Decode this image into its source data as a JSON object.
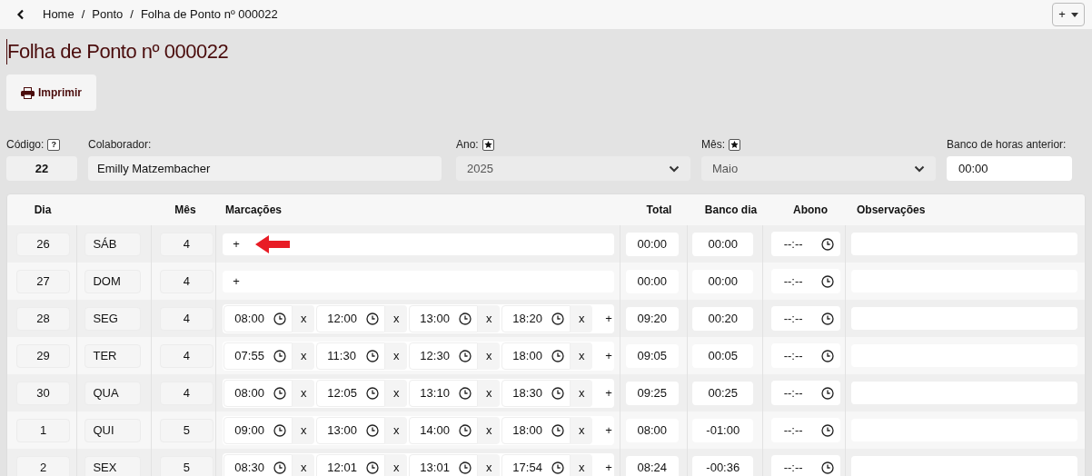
{
  "breadcrumb": [
    "Home",
    "Ponto",
    "Folha de Ponto nº 000022"
  ],
  "breadcrumb_separator": "/",
  "top_button": {
    "label": "+"
  },
  "title": "Folha de Ponto nº 000022",
  "print_button": {
    "label": "Imprimir"
  },
  "fields": [
    {
      "kind": "code",
      "label": "Código:",
      "badge": "?",
      "value": "22"
    },
    {
      "kind": "text",
      "label": "Colaborador:",
      "value": "Emilly Matzembacher"
    },
    {
      "kind": "select",
      "label": "Ano:",
      "starred": true,
      "value": "2025"
    },
    {
      "kind": "select",
      "label": "Mês:",
      "starred": true,
      "value": "Maio"
    },
    {
      "kind": "input",
      "label": "Banco de horas anterior:",
      "value": "00:00"
    }
  ],
  "table": {
    "columns": [
      "Dia",
      "",
      "Mês",
      "Marcações",
      "Total",
      "Banco dia",
      "Abono",
      "Observações"
    ],
    "rows": [
      {
        "dia": "26",
        "weekday": "SÁB",
        "mes": "4",
        "add": "+",
        "marks": [],
        "total": "00:00",
        "banco": "00:00",
        "abono": "--:--"
      },
      {
        "dia": "27",
        "weekday": "DOM",
        "mes": "4",
        "add": "+",
        "marks": [],
        "total": "00:00",
        "banco": "00:00",
        "abono": "--:--"
      },
      {
        "dia": "28",
        "weekday": "SEG",
        "mes": "4",
        "add": "+",
        "marks": [
          {
            "time": "08:00",
            "remove": "x"
          },
          {
            "time": "12:00",
            "remove": "x"
          },
          {
            "time": "13:00",
            "remove": "x"
          },
          {
            "time": "18:20",
            "remove": "x"
          }
        ],
        "total": "09:20",
        "banco": "00:20",
        "abono": "--:--"
      },
      {
        "dia": "29",
        "weekday": "TER",
        "mes": "4",
        "add": "+",
        "marks": [
          {
            "time": "07:55",
            "remove": "x"
          },
          {
            "time": "11:30",
            "remove": "x"
          },
          {
            "time": "12:30",
            "remove": "x"
          },
          {
            "time": "18:00",
            "remove": "x"
          }
        ],
        "total": "09:05",
        "banco": "00:05",
        "abono": "--:--"
      },
      {
        "dia": "30",
        "weekday": "QUA",
        "mes": "4",
        "add": "+",
        "marks": [
          {
            "time": "08:00",
            "remove": "x"
          },
          {
            "time": "12:05",
            "remove": "x"
          },
          {
            "time": "13:10",
            "remove": "x"
          },
          {
            "time": "18:30",
            "remove": "x"
          }
        ],
        "total": "09:25",
        "banco": "00:25",
        "abono": "--:--"
      },
      {
        "dia": "1",
        "weekday": "QUI",
        "mes": "5",
        "add": "+",
        "marks": [
          {
            "time": "09:00",
            "remove": "x"
          },
          {
            "time": "13:00",
            "remove": "x"
          },
          {
            "time": "14:00",
            "remove": "x"
          },
          {
            "time": "18:00",
            "remove": "x"
          }
        ],
        "total": "08:00",
        "banco": "-01:00",
        "abono": "--:--"
      },
      {
        "dia": "2",
        "weekday": "SEX",
        "mes": "5",
        "add": "+",
        "marks": [
          {
            "time": "08:30",
            "remove": "x"
          },
          {
            "time": "12:01",
            "remove": "x"
          },
          {
            "time": "13:01",
            "remove": "x"
          },
          {
            "time": "17:54",
            "remove": "x"
          }
        ],
        "total": "08:24",
        "banco": "-00:36",
        "abono": "--:--"
      }
    ]
  }
}
